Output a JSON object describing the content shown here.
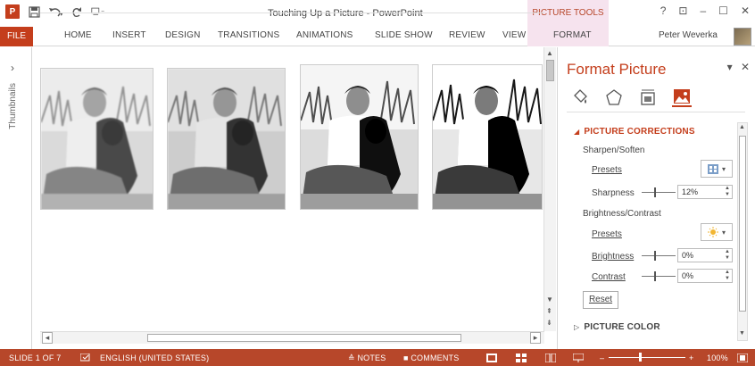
{
  "window": {
    "title": "Touching Up a Picture - PowerPoint",
    "contextual_tab_group": "PICTURE TOOLS",
    "buttons": {
      "help": "?",
      "restore_ribbon": "⊡",
      "minimize": "–",
      "maximize": "☐",
      "close": "✕"
    }
  },
  "quick_access": {
    "logo": "P",
    "icons": [
      "save-icon",
      "undo-icon",
      "redo-icon",
      "customize-icon"
    ]
  },
  "ribbon": {
    "tabs": [
      "FILE",
      "HOME",
      "INSERT",
      "DESIGN",
      "TRANSITIONS",
      "ANIMATIONS",
      "SLIDE SHOW",
      "REVIEW",
      "VIEW",
      "FORMAT"
    ],
    "user": "Peter Weverka"
  },
  "thumbnails": {
    "label": "Thumbnails",
    "chevron": "›"
  },
  "format_pane": {
    "title": "Format Picture",
    "close": "✕",
    "pin": "▾",
    "icon_tabs": [
      "fill-line-icon",
      "effects-icon",
      "size-properties-icon",
      "picture-icon"
    ],
    "sections": {
      "picture_corrections": {
        "label": "PICTURE CORRECTIONS",
        "sharpen_soften": {
          "label": "Sharpen/Soften",
          "presets_label": "Presets",
          "sharpness_label": "Sharpness",
          "sharpness_value": "12%",
          "sharpness_level": 0.5
        },
        "brightness_contrast": {
          "label": "Brightness/Contrast",
          "presets_label": "Presets",
          "brightness_label": "Brightness",
          "brightness_value": "0%",
          "brightness_level": 0.5,
          "contrast_label": "Contrast",
          "contrast_value": "0%",
          "contrast_level": 0.5
        },
        "reset_label": "Reset"
      },
      "picture_color": {
        "label": "PICTURE COLOR"
      }
    }
  },
  "status": {
    "slide": "SLIDE 1 OF 7",
    "language": "ENGLISH (UNITED STATES)",
    "notes": "NOTES",
    "comments": "COMMENTS",
    "zoom": "100%",
    "zoom_level": 0.5
  },
  "colors": {
    "accent": "#c43e1c",
    "status_bar": "#b7472a",
    "contextual_tab": "#f6e3ee"
  }
}
